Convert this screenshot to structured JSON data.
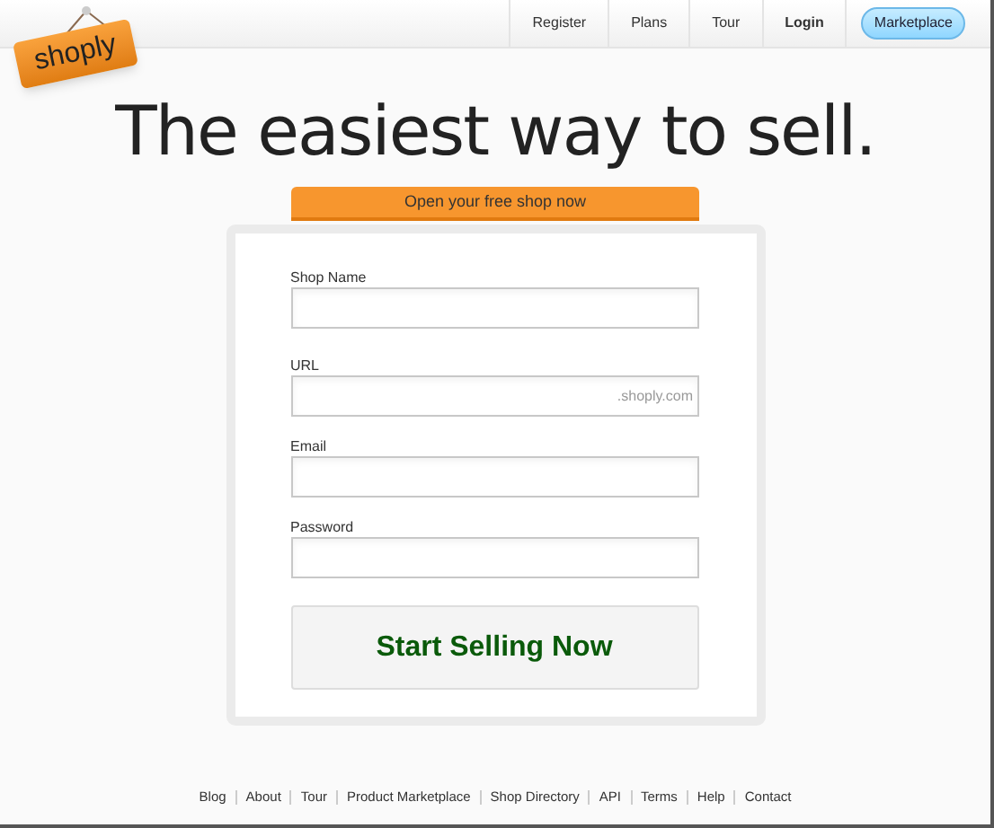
{
  "logo": {
    "text": "shoply"
  },
  "nav": [
    {
      "label": "Register",
      "kind": "link"
    },
    {
      "label": "Plans",
      "kind": "link"
    },
    {
      "label": "Tour",
      "kind": "link"
    },
    {
      "label": "Login",
      "kind": "strong"
    },
    {
      "label": "Marketplace",
      "kind": "pill"
    }
  ],
  "headline": "The easiest way to sell.",
  "form_tab": "Open your free shop now",
  "fields": [
    {
      "label": "Shop Name"
    },
    {
      "label": "URL",
      "suffix": ".shoply.com"
    },
    {
      "label": "Email"
    },
    {
      "label": "Password"
    }
  ],
  "submit": "Start Selling Now",
  "footer_links": [
    "Blog",
    "About",
    "Tour",
    "Product Marketplace",
    "Shop Directory",
    "API",
    "Terms",
    "Help",
    "Contact"
  ]
}
